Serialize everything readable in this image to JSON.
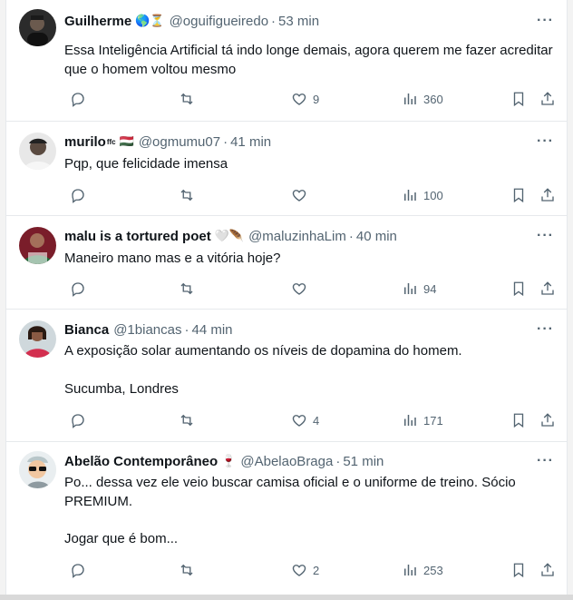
{
  "tweets": [
    {
      "name": "Guilherme",
      "badges": "🌎⏳",
      "handle": "@oguifigueiredo",
      "time": "53 min",
      "text": "Essa Inteligência Artificial tá indo longe demais, agora querem me fazer acreditar que o homem voltou mesmo",
      "likes": "9",
      "views": "360"
    },
    {
      "name": "murilo",
      "name_suffix": "ffc",
      "badges": "🇭🇺",
      "handle": "@ogmumu07",
      "time": "41 min",
      "text": "Pqp, que felicidade imensa",
      "likes": "",
      "views": "100"
    },
    {
      "name": "malu is a tortured poet",
      "badges": "🤍🪶",
      "handle": "@maluzinhaLim",
      "time": "40 min",
      "text": "Maneiro mano mas e a vitória hoje?",
      "likes": "",
      "views": "94"
    },
    {
      "name": "Bianca",
      "badges": "",
      "handle": "@1biancas",
      "time": "44 min",
      "text": "A exposição solar aumentando os níveis de dopamina do homem.",
      "text2": "Sucumba, Londres",
      "likes": "4",
      "views": "171"
    },
    {
      "name": "Abelão Contemporâneo",
      "badges": "🍷",
      "handle": "@AbelaoBraga",
      "time": "51 min",
      "text": "Po... dessa vez ele veio buscar camisa oficial e o uniforme de treino. Sócio PREMIUM.",
      "text2": "Jogar que é bom...",
      "likes": "2",
      "views": "253"
    }
  ],
  "more_label": "···",
  "separator": "·",
  "colors": {
    "text": "#0f1419",
    "secondary": "#536471",
    "border": "#e6e9ec"
  }
}
